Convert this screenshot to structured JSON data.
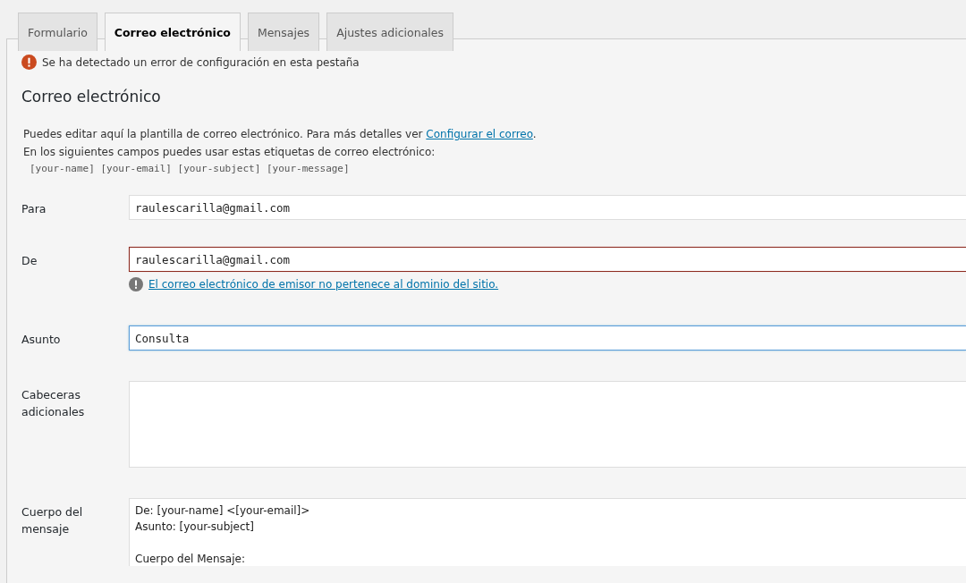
{
  "tabs": [
    {
      "label": "Formulario",
      "selected": false
    },
    {
      "label": "Correo electrónico",
      "selected": true
    },
    {
      "label": "Mensajes",
      "selected": false
    },
    {
      "label": "Ajustes adicionales",
      "selected": false
    }
  ],
  "error_notice": "Se ha detectado un error de configuración en esta pestaña",
  "section_title": "Correo electrónico",
  "description": {
    "text": "Puedes editar aquí la plantilla de correo electrónico. Para más detalles ver ",
    "link": "Configurar el correo",
    "after": ".",
    "line_2": "En los siguientes campos puedes usar estas etiquetas de correo electrónico:",
    "tags": "[your-name] [your-email] [your-subject] [your-message]"
  },
  "fields": [
    {
      "label": "Para",
      "kind": "input",
      "invalid": false,
      "focused": false,
      "value": "raulescarilla@gmail.com"
    },
    {
      "label": "De",
      "kind": "input",
      "invalid": true,
      "focused": false,
      "value": "raulescarilla@gmail.com",
      "note": "El correo electrónico de emisor no pertenece al dominio del sitio."
    },
    {
      "label": "Asunto",
      "kind": "input",
      "invalid": false,
      "focused": true,
      "value": "Consulta "
    },
    {
      "label": "Cabeceras adicionales",
      "kind": "textarea",
      "invalid": false,
      "focused": false
    },
    {
      "label": "Cuerpo del mensaje",
      "kind": "textarea",
      "invalid": false,
      "focused": false,
      "value": "De: [your-name] <[your-email]>\nAsunto: [your-subject]\n\nCuerpo del Mensaje:"
    }
  ]
}
